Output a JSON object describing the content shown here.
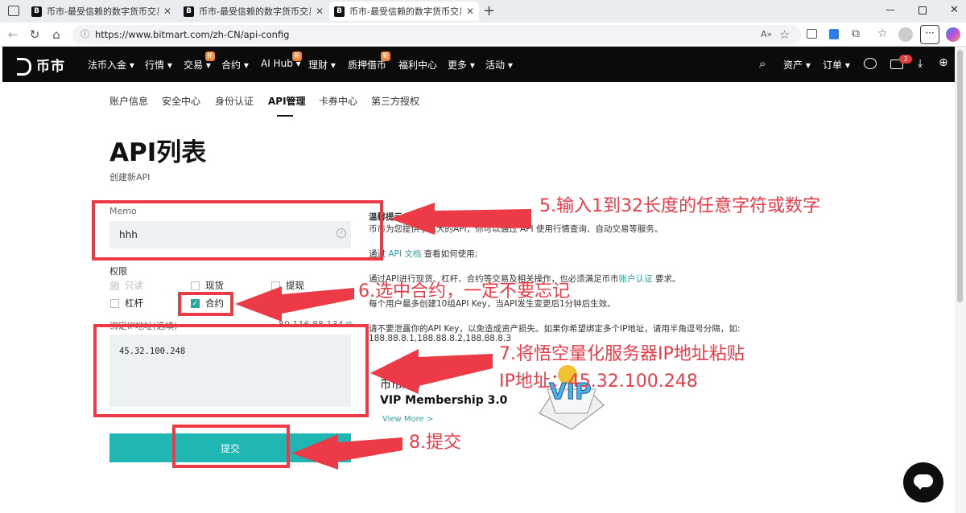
{
  "browser": {
    "tabs": [
      {
        "title": "币市-最受信赖的数字货币交易平台",
        "active": false
      },
      {
        "title": "币市-最受信赖的数字货币交易平台",
        "active": false
      },
      {
        "title": "币市-最受信赖的数字货币交易平台",
        "active": true
      }
    ],
    "url": "https://www.bitmart.com/zh-CN/api-config"
  },
  "site_header": {
    "logo": "币市",
    "nav": [
      {
        "label": "法币入金 ▾"
      },
      {
        "label": "行情 ▾"
      },
      {
        "label": "交易 ▾",
        "badge": "新"
      },
      {
        "label": "合约 ▾"
      },
      {
        "label": "AI Hub ▾",
        "badge": "新"
      },
      {
        "label": "理财 ▾"
      },
      {
        "label": "质押借币",
        "badge": "新"
      },
      {
        "label": "福利中心"
      },
      {
        "label": "更多 ▾"
      },
      {
        "label": "活动 ▾"
      }
    ],
    "right": {
      "assets": "资产 ▾",
      "orders": "订单 ▾",
      "mail_count": "2"
    }
  },
  "subnav": [
    "账户信息",
    "安全中心",
    "身份认证",
    "API管理",
    "卡券中心",
    "第三方授权"
  ],
  "page": {
    "title": "API列表",
    "subtitle": "创建新API",
    "memo_label": "Memo",
    "memo_value": "hhh",
    "permissions_label": "权限",
    "permissions": [
      {
        "label": "只读",
        "checked": true,
        "disabled": true
      },
      {
        "label": "现货",
        "checked": false
      },
      {
        "label": "提现",
        "checked": false
      },
      {
        "label": "杠杆",
        "checked": false
      },
      {
        "label": "合约",
        "checked": true
      }
    ],
    "ip_label": "绑定IP地址(选填)",
    "ip_current": "89.116.88.134",
    "ip_value": "45.32.100.248",
    "submit_label": "提交"
  },
  "tips": {
    "heading": "温馨提示",
    "line1": "币市为您提供了强大的API，你可以通过 API 使用行情查询、自动交易等服务。",
    "line2_pre": "通过",
    "line2_link": "API 文档",
    "line2_post": "查看如何使用;",
    "line3_pre": "通过API进行现货、杠杆、合约等交易及相关操作，也必须满足币市",
    "line3_link": "账户认证",
    "line3_post": "要求。",
    "line4": "每个用户最多创建10组API Key，当API发生变更后1分钟后生效。",
    "line5": "请不要泄露你的API Key，以免造成资产损失。如果你希望绑定多个IP地址，请用半角逗号分隔，如:",
    "line6": "188.88.8.1,188.88.8.2,188.88.8.3"
  },
  "promo": {
    "title": "币市API",
    "subtitle": "VIP Membership 3.0",
    "link": "View More >",
    "badge": "VIP"
  },
  "annotations": {
    "step5": "5.输入1到32长度的任意字符或数字",
    "step6": "6.选中合约，一定不要忘记",
    "step7a": "7.将悟空量化服务器IP地址粘贴",
    "step7b": "IP地址：45.32.100.248",
    "step8": "8.提交"
  },
  "colors": {
    "accent": "#1fb6b4",
    "annotation": "#ec3b47",
    "header_bg": "#0b0b0b"
  }
}
